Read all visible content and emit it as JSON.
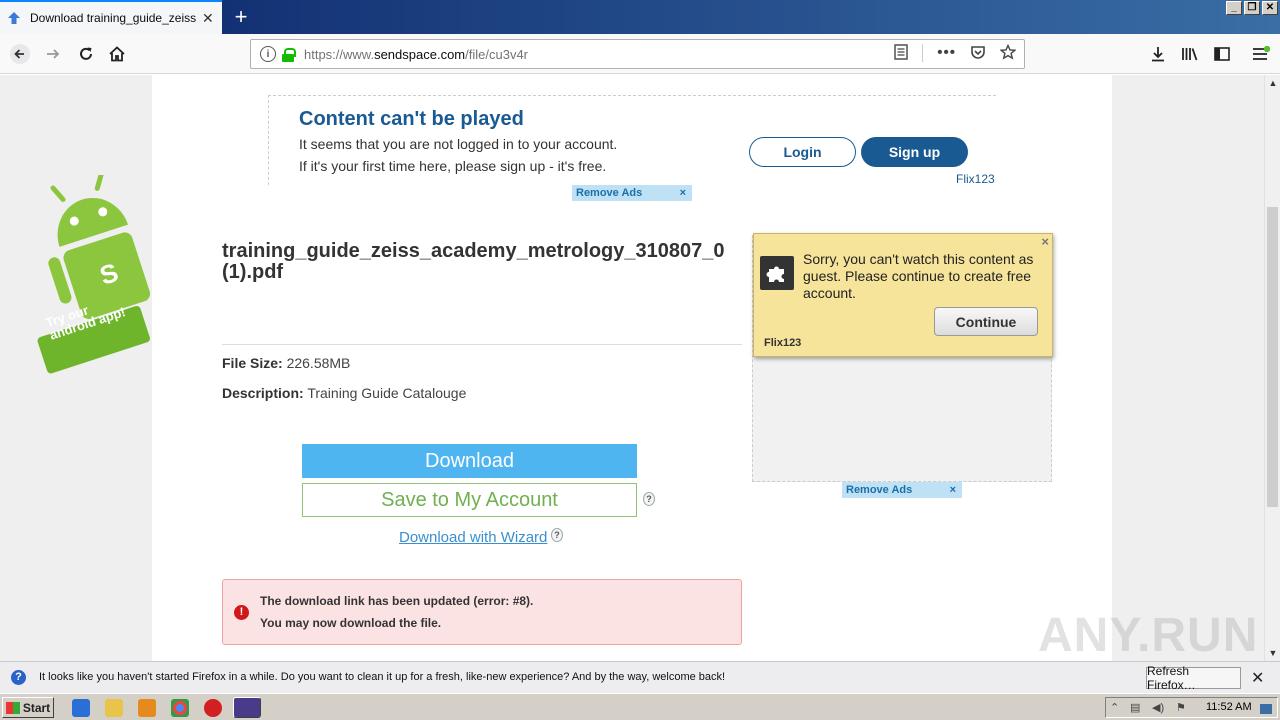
{
  "browser": {
    "tab_title": "Download training_guide_zeiss_ac",
    "url_prefix": "https://www.",
    "url_domain": "sendspace.com",
    "url_path": "/file/cu3v4r"
  },
  "banner": {
    "heading": "Content can't be played",
    "line1": "It seems that you are not logged in to your account.",
    "line2": "If it's your first time here, please sign up - it's free.",
    "login_label": "Login",
    "signup_label": "Sign up",
    "brand_link": "Flix123",
    "remove_ads": "Remove Ads",
    "remove_ads_close": "×"
  },
  "promo": {
    "text1": "Try our",
    "text2": "android app!"
  },
  "file": {
    "title_line1": "training_guide_zeiss_academy_metrology_310807_0",
    "title_line2": "(1).pdf",
    "size_label": "File Size:",
    "size_value": "226.58MB",
    "desc_label": "Description:",
    "desc_value": "Training Guide Catalouge"
  },
  "actions": {
    "download": "Download",
    "save": "Save to My Account",
    "wizard": "Download with Wizard",
    "hint": "?"
  },
  "error": {
    "line1": "The download link has been updated (error: #8).",
    "line2": "You may now download the file."
  },
  "popup": {
    "message": "Sorry, you can't watch this content as guest. Please continue to create free account.",
    "button": "Continue",
    "brand": "Flix123",
    "close": "×"
  },
  "ad_right": {
    "remove_ads": "Remove Ads",
    "remove_ads_close": "×"
  },
  "watermark": "ANY.RUN",
  "notification": {
    "text": "It looks like you haven't started Firefox in a while. Do you want to clean it up for a fresh, like-new experience? And by the way, welcome back!",
    "button": "Refresh Firefox…"
  },
  "taskbar": {
    "start": "Start",
    "clock": "11:52 AM"
  },
  "colors": {
    "link_blue": "#1a5a93",
    "download_blue": "#4eb5f1",
    "save_green": "#70b050",
    "error_bg": "#fbe3e4",
    "popup_bg": "#f6e49a"
  }
}
